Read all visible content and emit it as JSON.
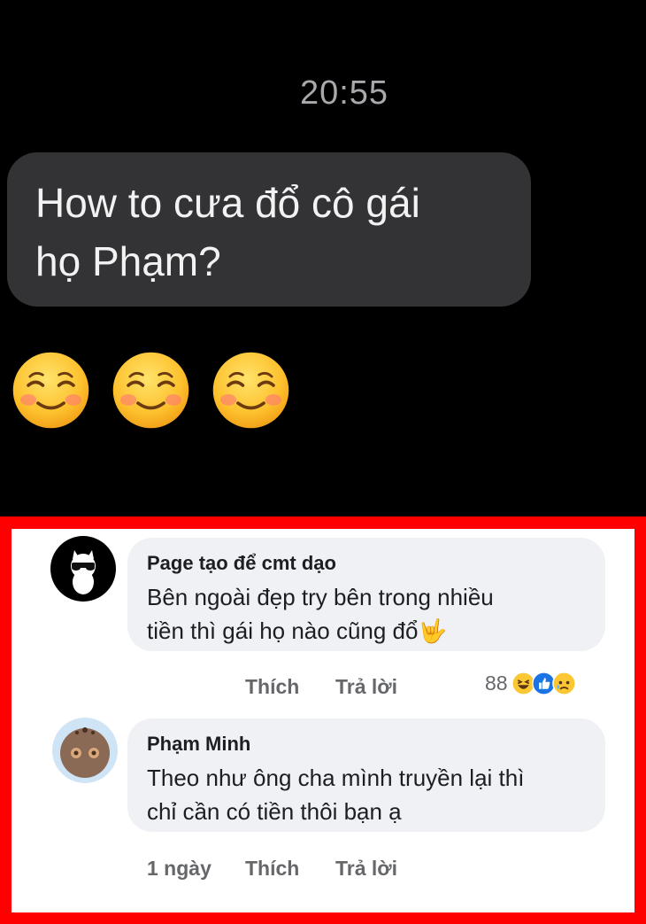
{
  "chat": {
    "timestamp": "20:55",
    "message_line1": "How to cưa đổ cô gái",
    "message_line2": "họ Phạm?",
    "emojis": [
      "smiling-face-icon",
      "smiling-face-icon",
      "smiling-face-icon"
    ]
  },
  "comments": [
    {
      "author": "Page tạo để cmt dạo",
      "line1": "Bên ngoài đẹp try bên trong nhiều",
      "line2": "tiền thì gái họ nào cũng đổ🤟",
      "time": "",
      "like_label": "Thích",
      "reply_label": "Trả lời",
      "reaction_count": "88",
      "reactions": [
        "haha-icon",
        "like-icon",
        "sad-icon"
      ]
    },
    {
      "author": "Phạm Minh",
      "line1": "Theo như ông cha mình truyền lại thì",
      "line2": "chỉ cần có tiền thôi bạn ạ",
      "time": "1 ngày",
      "like_label": "Thích",
      "reply_label": "Trả lời"
    }
  ],
  "colors": {
    "highlight_border": "#ff0000",
    "comment_bubble": "#eff1f4",
    "chat_bubble": "#333336"
  }
}
